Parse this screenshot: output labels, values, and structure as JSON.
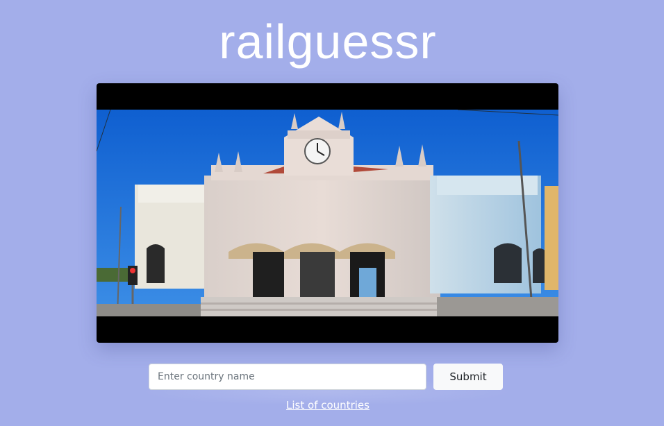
{
  "app": {
    "title": "railguessr"
  },
  "photo": {
    "subject": "railway station photo with clock tower"
  },
  "form": {
    "input_placeholder": "Enter country name",
    "input_value": "",
    "submit_label": "Submit"
  },
  "links": {
    "countries_label": "List of countries"
  },
  "colors": {
    "page_background": "#a3aeea",
    "button_background": "#f8f9fa",
    "sky": "#1c6fd8"
  },
  "icons": [
    "clock-icon"
  ]
}
